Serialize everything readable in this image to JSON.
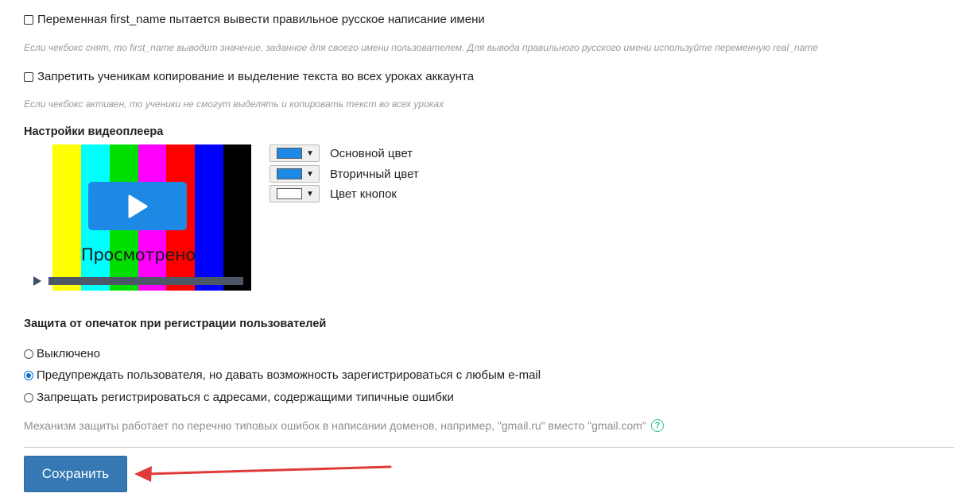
{
  "settings": {
    "first_name_checkbox": {
      "label": "Переменная first_name пытается вывести правильное русское написание имени",
      "checked": false,
      "hint": "Если чекбокс снят, то first_name выводит значение, заданное для своего имени пользователем. Для вывода правильного русского имени используйте переменную real_name"
    },
    "copy_protect_checkbox": {
      "label": "Запретить ученикам копирование и выделение текста во всех уроках аккаунта",
      "checked": false,
      "hint": "Если чекбокс активен, то ученики не смогут выделять и копировать текст во всех уроках"
    }
  },
  "video_player": {
    "heading": "Настройки видеоплеера",
    "preview": {
      "watched_label": "Просмотрено",
      "bars": [
        "#ffffff",
        "#ffff00",
        "#00ffff",
        "#00e000",
        "#ff00ff",
        "#ff0000",
        "#0000ff",
        "#000000"
      ]
    },
    "colors": [
      {
        "label": "Основной цвет",
        "value": "#1e88e5"
      },
      {
        "label": "Вторичный цвет",
        "value": "#1e88e5"
      },
      {
        "label": "Цвет кнопок",
        "value": "#ffffff"
      }
    ]
  },
  "typo_protection": {
    "heading": "Защита от опечаток при регистрации пользователей",
    "options": [
      {
        "label": "Выключено",
        "selected": false
      },
      {
        "label": "Предупреждать пользователя, но давать возможность зарегистрироваться с любым e-mail",
        "selected": true
      },
      {
        "label": "Запрещать регистрироваться с адресами, содержащими типичные ошибки",
        "selected": false
      }
    ],
    "note": "Механизм защиты работает по перечню типовых ошибок в написании доменов, например, \"gmail.ru\" вместо \"gmail.com\"",
    "help_icon": "?"
  },
  "save_button": {
    "label": "Сохранить"
  },
  "accent_colors": {
    "primary": "#3578b4",
    "radio": "#0a6fd6",
    "help": "#2fbf9f",
    "arrow": "#e03a3a"
  }
}
